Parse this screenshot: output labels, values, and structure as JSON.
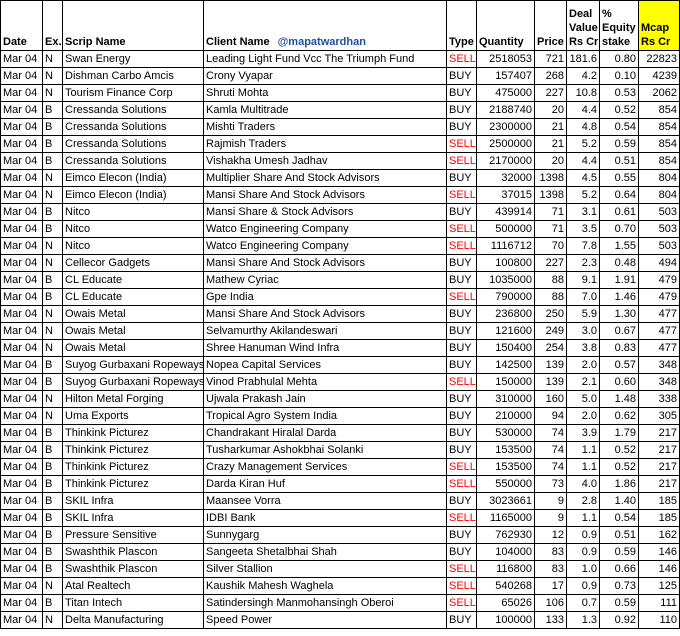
{
  "headers": {
    "date": "Date",
    "ex": "Ex.",
    "scrip": "Scrip Name",
    "client": "Client Name",
    "handle": "@mapatwardhan",
    "type": "Type",
    "quantity": "Quantity",
    "price": "Price",
    "deal_value": [
      "Deal",
      "Value",
      "Rs Cr"
    ],
    "equity_stake": [
      "%",
      "Equity",
      "stake"
    ],
    "mcap": [
      "Mcap",
      "Rs Cr"
    ]
  },
  "colors": {
    "sell": "#ff0000",
    "mcap_header": "#ffff00",
    "handle": "#1f4e9e"
  },
  "rows": [
    {
      "date": "Mar 04",
      "ex": "N",
      "scrip": "Swan Energy",
      "client": "Leading Light Fund Vcc The Triumph Fund",
      "type": "SELL",
      "qty": "2518053",
      "price": "721",
      "value": "181.6",
      "stake": "0.80",
      "mcap": "22823"
    },
    {
      "date": "Mar 04",
      "ex": "N",
      "scrip": "Dishman Carbo Amcis",
      "client": "Crony Vyapar",
      "type": "BUY",
      "qty": "157407",
      "price": "268",
      "value": "4.2",
      "stake": "0.10",
      "mcap": "4239"
    },
    {
      "date": "Mar 04",
      "ex": "N",
      "scrip": "Tourism Finance Corp",
      "client": "Shruti  Mohta",
      "type": "BUY",
      "qty": "475000",
      "price": "227",
      "value": "10.8",
      "stake": "0.53",
      "mcap": "2062"
    },
    {
      "date": "Mar 04",
      "ex": "B",
      "scrip": "Cressanda Solutions",
      "client": "Kamla Multitrade",
      "type": "BUY",
      "qty": "2188740",
      "price": "20",
      "value": "4.4",
      "stake": "0.52",
      "mcap": "854"
    },
    {
      "date": "Mar 04",
      "ex": "B",
      "scrip": "Cressanda Solutions",
      "client": "Mishti Traders",
      "type": "BUY",
      "qty": "2300000",
      "price": "21",
      "value": "4.8",
      "stake": "0.54",
      "mcap": "854"
    },
    {
      "date": "Mar 04",
      "ex": "B",
      "scrip": "Cressanda Solutions",
      "client": "Rajmish Traders",
      "type": "SELL",
      "qty": "2500000",
      "price": "21",
      "value": "5.2",
      "stake": "0.59",
      "mcap": "854"
    },
    {
      "date": "Mar 04",
      "ex": "B",
      "scrip": "Cressanda Solutions",
      "client": "Vishakha Umesh Jadhav",
      "type": "SELL",
      "qty": "2170000",
      "price": "20",
      "value": "4.4",
      "stake": "0.51",
      "mcap": "854"
    },
    {
      "date": "Mar 04",
      "ex": "N",
      "scrip": "Eimco Elecon (India)",
      "client": "Multiplier Share And Stock Advisors",
      "type": "BUY",
      "qty": "32000",
      "price": "1398",
      "value": "4.5",
      "stake": "0.55",
      "mcap": "804"
    },
    {
      "date": "Mar 04",
      "ex": "N",
      "scrip": "Eimco Elecon (India)",
      "client": "Mansi Share And Stock Advisors",
      "type": "SELL",
      "qty": "37015",
      "price": "1398",
      "value": "5.2",
      "stake": "0.64",
      "mcap": "804"
    },
    {
      "date": "Mar 04",
      "ex": "B",
      "scrip": "Nitco",
      "client": "Mansi Share & Stock Advisors",
      "type": "BUY",
      "qty": "439914",
      "price": "71",
      "value": "3.1",
      "stake": "0.61",
      "mcap": "503"
    },
    {
      "date": "Mar 04",
      "ex": "B",
      "scrip": "Nitco",
      "client": "Watco Engineering Company",
      "type": "SELL",
      "qty": "500000",
      "price": "71",
      "value": "3.5",
      "stake": "0.70",
      "mcap": "503"
    },
    {
      "date": "Mar 04",
      "ex": "N",
      "scrip": "Nitco",
      "client": "Watco Engineering Company",
      "type": "SELL",
      "qty": "1116712",
      "price": "70",
      "value": "7.8",
      "stake": "1.55",
      "mcap": "503"
    },
    {
      "date": "Mar 04",
      "ex": "N",
      "scrip": "Cellecor Gadgets",
      "client": "Mansi Share And Stock Advisors",
      "type": "BUY",
      "qty": "100800",
      "price": "227",
      "value": "2.3",
      "stake": "0.48",
      "mcap": "494"
    },
    {
      "date": "Mar 04",
      "ex": "B",
      "scrip": "CL Educate",
      "client": "Mathew Cyriac",
      "type": "BUY",
      "qty": "1035000",
      "price": "88",
      "value": "9.1",
      "stake": "1.91",
      "mcap": "479"
    },
    {
      "date": "Mar 04",
      "ex": "B",
      "scrip": "CL Educate",
      "client": "Gpe India",
      "type": "SELL",
      "qty": "790000",
      "price": "88",
      "value": "7.0",
      "stake": "1.46",
      "mcap": "479"
    },
    {
      "date": "Mar 04",
      "ex": "N",
      "scrip": "Owais Metal",
      "client": "Mansi Share And Stock Advisors",
      "type": "BUY",
      "qty": "236800",
      "price": "250",
      "value": "5.9",
      "stake": "1.30",
      "mcap": "477"
    },
    {
      "date": "Mar 04",
      "ex": "N",
      "scrip": "Owais Metal",
      "client": "Selvamurthy   Akilandeswari",
      "type": "BUY",
      "qty": "121600",
      "price": "249",
      "value": "3.0",
      "stake": "0.67",
      "mcap": "477"
    },
    {
      "date": "Mar 04",
      "ex": "N",
      "scrip": "Owais Metal",
      "client": "Shree Hanuman Wind Infra",
      "type": "BUY",
      "qty": "150400",
      "price": "254",
      "value": "3.8",
      "stake": "0.83",
      "mcap": "477"
    },
    {
      "date": "Mar 04",
      "ex": "B",
      "scrip": "Suyog Gurbaxani Ropeways",
      "client": "Nopea Capital Services",
      "type": "BUY",
      "qty": "142500",
      "price": "139",
      "value": "2.0",
      "stake": "0.57",
      "mcap": "348"
    },
    {
      "date": "Mar 04",
      "ex": "B",
      "scrip": "Suyog Gurbaxani Ropeways",
      "client": "Vinod Prabhulal Mehta",
      "type": "SELL",
      "qty": "150000",
      "price": "139",
      "value": "2.1",
      "stake": "0.60",
      "mcap": "348"
    },
    {
      "date": "Mar 04",
      "ex": "N",
      "scrip": "Hilton Metal Forging",
      "client": "Ujwala Prakash Jain",
      "type": "BUY",
      "qty": "310000",
      "price": "160",
      "value": "5.0",
      "stake": "1.48",
      "mcap": "338"
    },
    {
      "date": "Mar 04",
      "ex": "N",
      "scrip": "Uma Exports",
      "client": "Tropical Agro System India",
      "type": "BUY",
      "qty": "210000",
      "price": "94",
      "value": "2.0",
      "stake": "0.62",
      "mcap": "305"
    },
    {
      "date": "Mar 04",
      "ex": "B",
      "scrip": "Thinkink Picturez",
      "client": "Chandrakant Hiralal Darda",
      "type": "BUY",
      "qty": "530000",
      "price": "74",
      "value": "3.9",
      "stake": "1.79",
      "mcap": "217"
    },
    {
      "date": "Mar 04",
      "ex": "B",
      "scrip": "Thinkink Picturez",
      "client": "Tusharkumar Ashokbhai Solanki",
      "type": "BUY",
      "qty": "153500",
      "price": "74",
      "value": "1.1",
      "stake": "0.52",
      "mcap": "217"
    },
    {
      "date": "Mar 04",
      "ex": "B",
      "scrip": "Thinkink Picturez",
      "client": "Crazy Management Services",
      "type": "SELL",
      "qty": "153500",
      "price": "74",
      "value": "1.1",
      "stake": "0.52",
      "mcap": "217"
    },
    {
      "date": "Mar 04",
      "ex": "B",
      "scrip": "Thinkink Picturez",
      "client": "Darda Kiran Huf",
      "type": "SELL",
      "qty": "550000",
      "price": "73",
      "value": "4.0",
      "stake": "1.86",
      "mcap": "217"
    },
    {
      "date": "Mar 04",
      "ex": "B",
      "scrip": "SKIL Infra",
      "client": "Maansee Vorra",
      "type": "BUY",
      "qty": "3023661",
      "price": "9",
      "value": "2.8",
      "stake": "1.40",
      "mcap": "185"
    },
    {
      "date": "Mar 04",
      "ex": "B",
      "scrip": "SKIL Infra",
      "client": "IDBI Bank",
      "type": "SELL",
      "qty": "1165000",
      "price": "9",
      "value": "1.1",
      "stake": "0.54",
      "mcap": "185"
    },
    {
      "date": "Mar 04",
      "ex": "B",
      "scrip": "Pressure Sensitive",
      "client": "Sunnygarg",
      "type": "BUY",
      "qty": "762930",
      "price": "12",
      "value": "0.9",
      "stake": "0.51",
      "mcap": "162"
    },
    {
      "date": "Mar 04",
      "ex": "B",
      "scrip": "Swashthik Plascon",
      "client": "Sangeeta Shetalbhai Shah",
      "type": "BUY",
      "qty": "104000",
      "price": "83",
      "value": "0.9",
      "stake": "0.59",
      "mcap": "146"
    },
    {
      "date": "Mar 04",
      "ex": "B",
      "scrip": "Swashthik Plascon",
      "client": "Silver Stallion",
      "type": "SELL",
      "qty": "116800",
      "price": "83",
      "value": "1.0",
      "stake": "0.66",
      "mcap": "146"
    },
    {
      "date": "Mar 04",
      "ex": "N",
      "scrip": "Atal Realtech",
      "client": "Kaushik Mahesh Waghela",
      "type": "SELL",
      "qty": "540268",
      "price": "17",
      "value": "0.9",
      "stake": "0.73",
      "mcap": "125"
    },
    {
      "date": "Mar 04",
      "ex": "B",
      "scrip": "Titan Intech",
      "client": "Satindersingh Manmohansingh Oberoi",
      "type": "SELL",
      "qty": "65026",
      "price": "106",
      "value": "0.7",
      "stake": "0.59",
      "mcap": "111"
    },
    {
      "date": "Mar 04",
      "ex": "N",
      "scrip": "Delta Manufacturing",
      "client": "Speed Power",
      "type": "BUY",
      "qty": "100000",
      "price": "133",
      "value": "1.3",
      "stake": "0.92",
      "mcap": "110"
    }
  ]
}
